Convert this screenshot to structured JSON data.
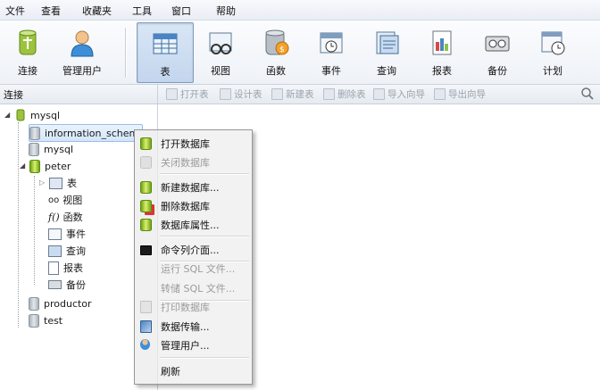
{
  "menubar": {
    "items": [
      "文件",
      "查看",
      "收藏夹",
      "工具",
      "窗口",
      "帮助"
    ]
  },
  "toolbar": {
    "buttons": [
      {
        "label": "连接",
        "icon": "connection-icon"
      },
      {
        "label": "管理用户",
        "icon": "user-icon"
      },
      {
        "label": "表",
        "icon": "table-icon",
        "active": true
      },
      {
        "label": "视图",
        "icon": "view-icon"
      },
      {
        "label": "函数",
        "icon": "function-icon"
      },
      {
        "label": "事件",
        "icon": "event-icon"
      },
      {
        "label": "查询",
        "icon": "query-icon"
      },
      {
        "label": "报表",
        "icon": "report-icon"
      },
      {
        "label": "备份",
        "icon": "backup-icon"
      },
      {
        "label": "计划",
        "icon": "schedule-icon"
      }
    ]
  },
  "object_toolbar": {
    "connection_label": "连接",
    "buttons": [
      "打开表",
      "设计表",
      "新建表",
      "删除表",
      "导入向导",
      "导出向导"
    ]
  },
  "tree": {
    "connection": "mysql",
    "databases": [
      {
        "name": "information_schem",
        "selected": true
      },
      {
        "name": "mysql"
      },
      {
        "name": "peter",
        "open": true,
        "children": [
          "表",
          "视图",
          "函数",
          "事件",
          "查询",
          "报表",
          "备份"
        ]
      },
      {
        "name": "productor"
      },
      {
        "name": "test"
      }
    ]
  },
  "context_menu": {
    "items": [
      {
        "label": "打开数据库",
        "enabled": true,
        "icon": "open-db-icon"
      },
      {
        "label": "关闭数据库",
        "enabled": false,
        "icon": "close-db-icon"
      },
      {
        "label": "新建数据库...",
        "enabled": true,
        "icon": "new-db-icon"
      },
      {
        "label": "删除数据库",
        "enabled": true,
        "icon": "delete-db-icon"
      },
      {
        "label": "数据库属性...",
        "enabled": true,
        "icon": "db-properties-icon"
      },
      {
        "label": "命令列介面...",
        "enabled": true,
        "icon": "console-icon"
      },
      {
        "label": "运行 SQL 文件...",
        "enabled": false
      },
      {
        "label": "转储 SQL 文件...",
        "enabled": false
      },
      {
        "label": "打印数据库",
        "enabled": false,
        "icon": "print-icon"
      },
      {
        "label": "数据传输...",
        "enabled": true,
        "icon": "data-transfer-icon"
      },
      {
        "label": "管理用户...",
        "enabled": true,
        "icon": "manage-user-icon"
      },
      {
        "label": "刷新",
        "enabled": true
      }
    ]
  },
  "colors": {
    "accent": "#7f9dbf",
    "db_green": "#6ea414"
  }
}
